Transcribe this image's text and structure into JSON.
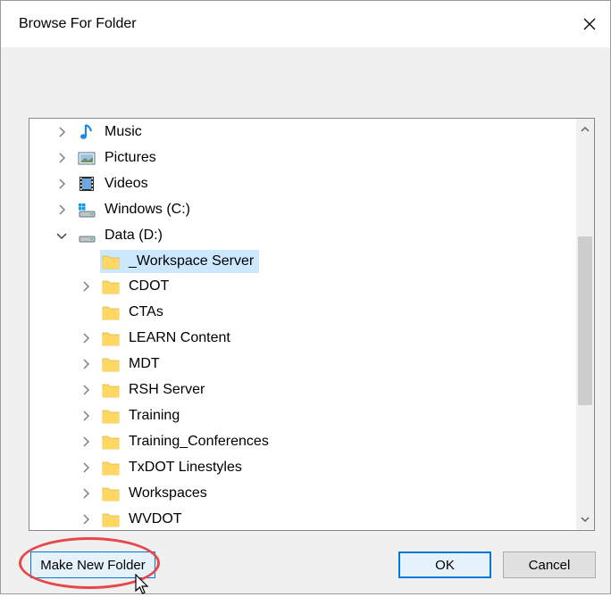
{
  "window": {
    "title": "Browse For Folder"
  },
  "tree": {
    "items": [
      {
        "label": "Music",
        "icon": "music-note-icon",
        "expandable": true,
        "expanded": false,
        "level": 0
      },
      {
        "label": "Pictures",
        "icon": "pictures-icon",
        "expandable": true,
        "expanded": false,
        "level": 0
      },
      {
        "label": "Videos",
        "icon": "videos-icon",
        "expandable": true,
        "expanded": false,
        "level": 0
      },
      {
        "label": "Windows (C:)",
        "icon": "windows-drive-icon",
        "expandable": true,
        "expanded": false,
        "level": 0
      },
      {
        "label": "Data (D:)",
        "icon": "drive-icon",
        "expandable": true,
        "expanded": true,
        "level": 0
      },
      {
        "label": "_Workspace Server",
        "icon": "folder-icon",
        "expandable": false,
        "level": 1,
        "selected": true
      },
      {
        "label": "CDOT",
        "icon": "folder-icon",
        "expandable": true,
        "level": 1
      },
      {
        "label": "CTAs",
        "icon": "folder-icon",
        "expandable": false,
        "level": 1
      },
      {
        "label": "LEARN Content",
        "icon": "folder-icon",
        "expandable": true,
        "level": 1
      },
      {
        "label": "MDT",
        "icon": "folder-icon",
        "expandable": true,
        "level": 1
      },
      {
        "label": "RSH Server",
        "icon": "folder-icon",
        "expandable": true,
        "level": 1
      },
      {
        "label": "Training",
        "icon": "folder-icon",
        "expandable": true,
        "level": 1
      },
      {
        "label": "Training_Conferences",
        "icon": "folder-icon",
        "expandable": true,
        "level": 1
      },
      {
        "label": "TxDOT Linestyles",
        "icon": "folder-icon",
        "expandable": true,
        "level": 1
      },
      {
        "label": "Workspaces",
        "icon": "folder-icon",
        "expandable": true,
        "level": 1
      },
      {
        "label": "WVDOT",
        "icon": "folder-icon",
        "expandable": true,
        "level": 1
      }
    ]
  },
  "buttons": {
    "make_new_folder": "Make New Folder",
    "ok": "OK",
    "cancel": "Cancel"
  },
  "colors": {
    "selection": "#cce8ff",
    "accent": "#0078d7",
    "annotation_ring": "#e5474b",
    "folder": "#ffd863"
  }
}
